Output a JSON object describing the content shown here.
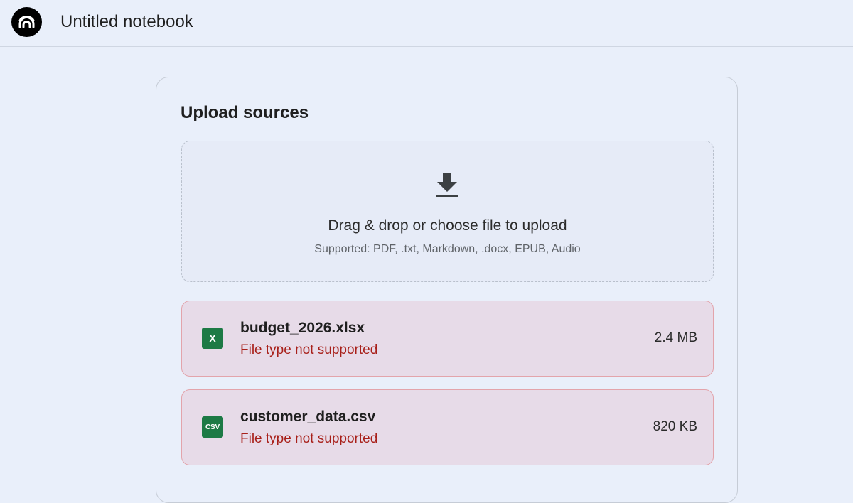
{
  "header": {
    "notebook_title": "Untitled notebook",
    "logo_icon": "notebook-logo-icon"
  },
  "upload": {
    "title": "Upload sources",
    "dropzone": {
      "icon": "download-arrow-icon",
      "main_text": "Drag & drop or choose file to upload",
      "supported_text": "Supported: PDF, .txt, Markdown, .docx, EPUB, Audio"
    },
    "files": [
      {
        "name": "budget_2026.xlsx",
        "badge": "X",
        "icon": "excel-file-icon",
        "status": "File type not supported",
        "size": "2.4 MB"
      },
      {
        "name": "customer_data.csv",
        "badge": "CSV",
        "icon": "csv-file-icon",
        "status": "File type not supported",
        "size": "820 KB"
      }
    ]
  },
  "colors": {
    "background": "#e9effa",
    "error_text": "#a8201a",
    "error_border": "#e3a4ab",
    "error_bg": "#e7dbe8",
    "file_badge": "#1d7a45"
  }
}
